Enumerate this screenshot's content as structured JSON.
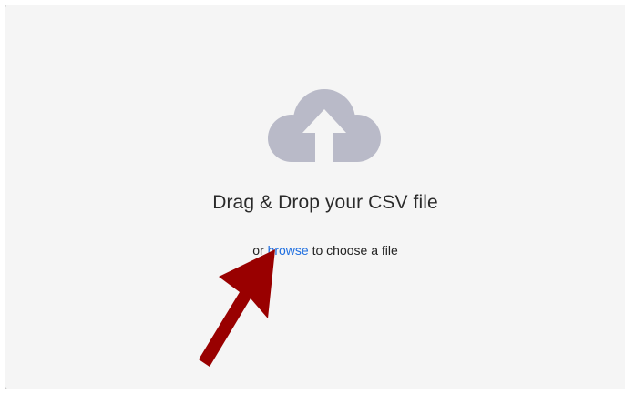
{
  "upload": {
    "title": "Drag & Drop your CSV file",
    "subtitle_prefix": "or",
    "browse_label": "browse",
    "subtitle_suffix": "to choose a file"
  },
  "icons": {
    "upload": "cloud-upload-icon",
    "annotation": "arrow-annotation-icon"
  },
  "colors": {
    "background": "#f5f5f5",
    "border": "#c6c6c6",
    "cloud": "#b9bac8",
    "link": "#1f6fe0",
    "arrow": "#990000"
  }
}
